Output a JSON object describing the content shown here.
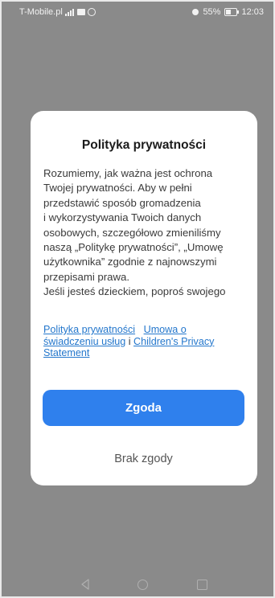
{
  "status_bar": {
    "carrier": "T-Mobile.pl",
    "battery": "55%",
    "time": "12:03",
    "icons": [
      "signal-icon",
      "message-icon",
      "circle-icon",
      "alarm-icon",
      "battery-icon"
    ]
  },
  "dialog": {
    "title": "Polityka prywatności",
    "body_lines": [
      "Rozumiemy, jak ważna jest ochrona",
      "Twojej prywatności. Aby w pełni",
      "przedstawić sposób gromadzenia",
      "i wykorzystywania Twoich danych",
      "osobowych, szczegółowo zmieniliśmy",
      "naszą „Politykę prywatności”, „Umowę",
      "użytkownika” zgodnie z najnowszymi",
      "przepisami prawa.",
      "Jeśli jesteś dzieckiem, poproś swojego"
    ],
    "links": {
      "privacy_policy": "Polityka prywatności",
      "service_agreement_line1": "Umowa o",
      "service_agreement_line2": "świadczeniu usług",
      "connector": "i",
      "childrens_privacy_line1": "Children's Privacy",
      "childrens_privacy_line2": "Statement"
    },
    "accept_label": "Zgoda",
    "reject_label": "Brak zgody"
  },
  "nav_bar": {
    "icons": [
      "back-icon",
      "home-icon",
      "recent-apps-icon"
    ]
  },
  "colors": {
    "backdrop": "#8a8a8a",
    "accent": "#2f80ed",
    "link": "#2477cc"
  }
}
